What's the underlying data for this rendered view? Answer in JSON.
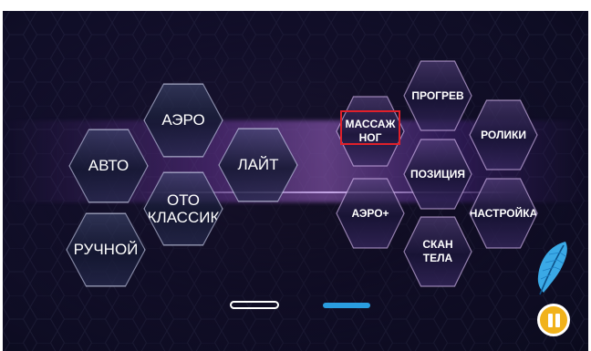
{
  "modes": {
    "avto": "АВТО",
    "aero": "АЭРО",
    "layt": "ЛАЙТ",
    "oto_klassik": "ОТО\nКЛАССИК",
    "ruchnoy": "РУЧНОЙ"
  },
  "functions": {
    "progrev": "ПРОГРЕВ",
    "massazh_nog": "МАССАЖ\nНОГ",
    "roliki": "РОЛИКИ",
    "pozitsiya": "ПОЗИЦИЯ",
    "aero_plus": "АЭРО+",
    "nastroyka": "НАСТРОЙКА",
    "skan_tela": "СКАН\nТЕЛА"
  },
  "selected_function": "massazh_nog",
  "pager": {
    "pages": 2,
    "active_page": 2
  },
  "colors": {
    "accent_blue": "#2a9de0",
    "pause_yellow": "#f1b21b",
    "selection_red": "#e0202a",
    "feather_blue": "#3aa9e6"
  },
  "icons": {
    "feather": "feather-icon",
    "pause": "pause-icon"
  }
}
